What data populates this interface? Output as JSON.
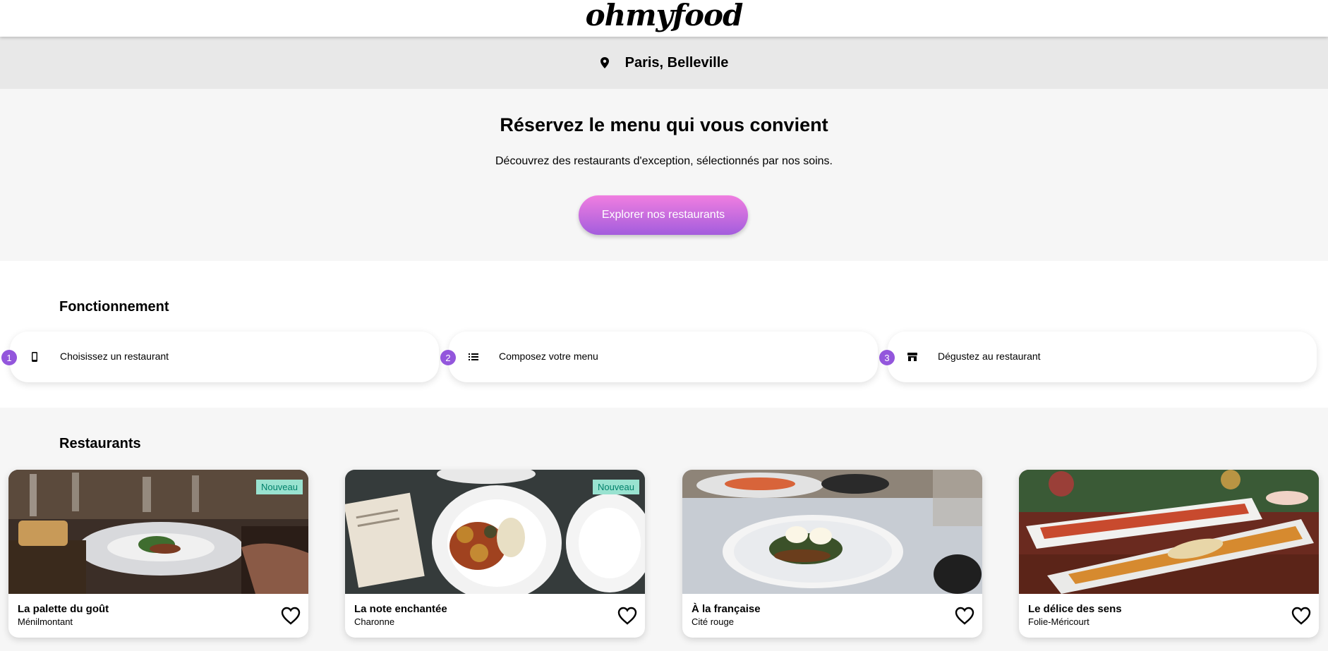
{
  "header": {
    "logo": "ohmyfood"
  },
  "location": {
    "icon": "map-pin-icon",
    "label": "Paris, Belleville"
  },
  "hero": {
    "title": "Réservez le menu qui vous convient",
    "subtitle": "Découvrez des restaurants d'exception, sélectionnés par nos soins.",
    "cta_label": "Explorer nos restaurants"
  },
  "how": {
    "title": "Fonctionnement",
    "steps": [
      {
        "number": "1",
        "icon": "mobile-phone-icon",
        "label": "Choisissez un restaurant"
      },
      {
        "number": "2",
        "icon": "list-icon",
        "label": "Composez votre menu"
      },
      {
        "number": "3",
        "icon": "shop-icon",
        "label": "Dégustez au restaurant"
      }
    ]
  },
  "restaurants": {
    "title": "Restaurants",
    "items": [
      {
        "name": "La palette du goût",
        "area": "Ménilmontant",
        "badge": "Nouveau"
      },
      {
        "name": "La note enchantée",
        "area": "Charonne",
        "badge": "Nouveau"
      },
      {
        "name": "À la française",
        "area": "Cité rouge"
      },
      {
        "name": "Le délice des sens",
        "area": "Folie-Méricourt"
      }
    ]
  },
  "colors": {
    "accent_purple": "#9356dc",
    "cta_gradient_top": "#f07ee0",
    "cta_gradient_bottom": "#a35ddd",
    "badge_bg": "#99e2d0",
    "badge_text": "#00806a"
  }
}
